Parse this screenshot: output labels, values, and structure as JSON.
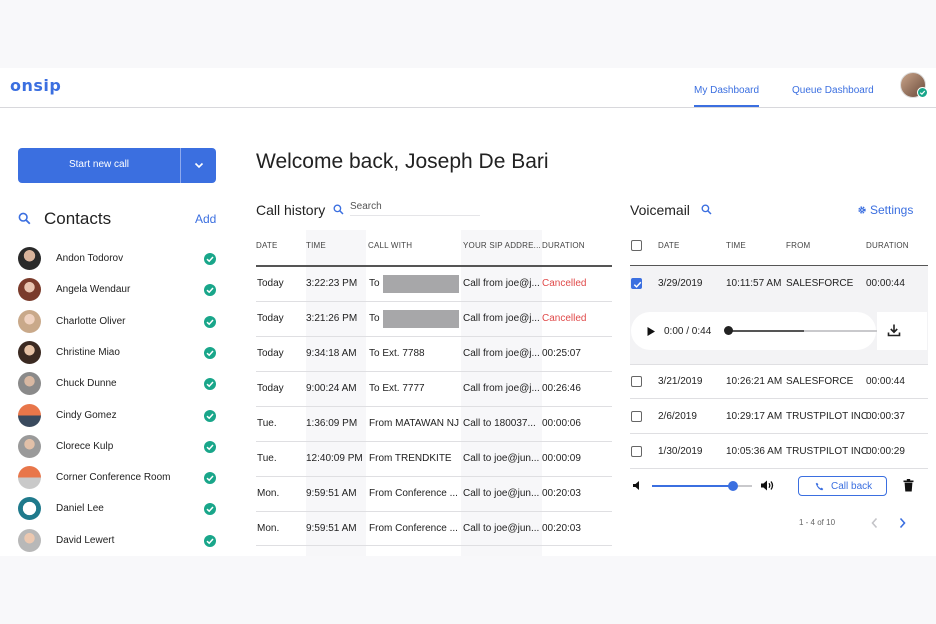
{
  "header": {
    "logo": "onsip",
    "tabs": [
      {
        "label": "My Dashboard",
        "active": true
      },
      {
        "label": "Queue Dashboard",
        "active": false
      }
    ]
  },
  "sidebar": {
    "start_call_label": "Start new call",
    "contacts_title": "Contacts",
    "add_label": "Add",
    "contacts": [
      {
        "name": "Andon Todorov",
        "status": "available"
      },
      {
        "name": "Angela Wendaur",
        "status": "available"
      },
      {
        "name": "Charlotte Oliver",
        "status": "available"
      },
      {
        "name": "Christine Miao",
        "status": "available"
      },
      {
        "name": "Chuck Dunne",
        "status": "available"
      },
      {
        "name": "Cindy Gomez",
        "status": "available"
      },
      {
        "name": "Clorece Kulp",
        "status": "available"
      },
      {
        "name": "Corner Conference Room",
        "status": "available"
      },
      {
        "name": "Daniel Lee",
        "status": "available"
      },
      {
        "name": "David Lewert",
        "status": "available"
      }
    ]
  },
  "welcome": "Welcome back, Joseph De Bari",
  "call_history": {
    "title": "Call history",
    "search_placeholder": "Search",
    "columns": [
      "DATE",
      "TIME",
      "CALL WITH",
      "YOUR SIP ADDRE...",
      "DURATION"
    ],
    "rows": [
      {
        "date": "Today",
        "time": "3:22:23 PM",
        "call_with": "To",
        "redacted": true,
        "sip": "Call from joe@j...",
        "duration": "Cancelled",
        "cancelled": true
      },
      {
        "date": "Today",
        "time": "3:21:26 PM",
        "call_with": "To",
        "redacted": true,
        "sip": "Call from joe@j...",
        "duration": "Cancelled",
        "cancelled": true
      },
      {
        "date": "Today",
        "time": "9:34:18 AM",
        "call_with": "To Ext. 7788",
        "redacted": false,
        "sip": "Call from joe@j...",
        "duration": "00:25:07",
        "cancelled": false
      },
      {
        "date": "Today",
        "time": "9:00:24 AM",
        "call_with": "To Ext. 7777",
        "redacted": false,
        "sip": "Call from joe@j...",
        "duration": "00:26:46",
        "cancelled": false
      },
      {
        "date": "Tue.",
        "time": "1:36:09 PM",
        "call_with": "From MATAWAN NJ",
        "redacted": false,
        "sip": "Call to 180037...",
        "duration": "00:00:06",
        "cancelled": false
      },
      {
        "date": "Tue.",
        "time": "12:40:09 PM",
        "call_with": "From TRENDKITE",
        "redacted": false,
        "sip": "Call to joe@jun...",
        "duration": "00:00:09",
        "cancelled": false
      },
      {
        "date": "Mon.",
        "time": "9:59:51 AM",
        "call_with": "From Conference ...",
        "redacted": false,
        "sip": "Call to joe@jun...",
        "duration": "00:20:03",
        "cancelled": false
      },
      {
        "date": "Mon.",
        "time": "9:59:51 AM",
        "call_with": "From Conference ...",
        "redacted": false,
        "sip": "Call to joe@jun...",
        "duration": "00:20:03",
        "cancelled": false
      }
    ]
  },
  "voicemail": {
    "title": "Voicemail",
    "settings_label": "Settings",
    "columns": [
      "DATE",
      "TIME",
      "FROM",
      "DURATION"
    ],
    "rows": [
      {
        "date": "3/29/2019",
        "time": "10:11:57 AM",
        "from": "SALESFORCE",
        "duration": "00:00:44",
        "checked": true
      },
      {
        "date": "3/21/2019",
        "time": "10:26:21 AM",
        "from": "SALESFORCE",
        "duration": "00:00:44",
        "checked": false
      },
      {
        "date": "2/6/2019",
        "time": "10:29:17 AM",
        "from": "TRUSTPILOT INC",
        "duration": "00:00:37",
        "checked": false
      },
      {
        "date": "1/30/2019",
        "time": "10:05:36 AM",
        "from": "TRUSTPILOT INC",
        "duration": "00:00:29",
        "checked": false
      }
    ],
    "player": {
      "time": "0:00 / 0:44",
      "progress": 0.5
    },
    "volume": 0.82,
    "callback_label": "Call back",
    "pagination": "1 - 4 of 10"
  },
  "colors": {
    "accent": "#3b6fe0",
    "available": "#19a68a",
    "cancelled": "#e04a4a"
  }
}
